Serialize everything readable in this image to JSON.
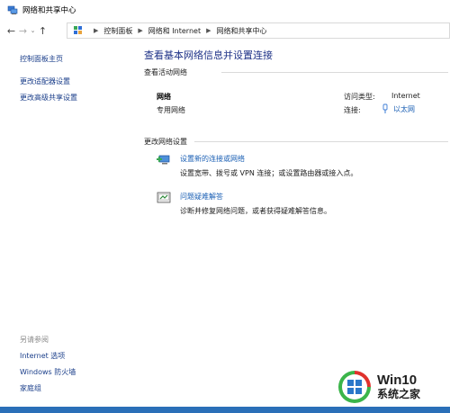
{
  "window": {
    "title": "网络和共享中心"
  },
  "address_bar": {
    "breadcrumbs": [
      "控制面板",
      "网络和 Internet",
      "网络和共享中心"
    ]
  },
  "left_pane": {
    "links": [
      "控制面板主页",
      "更改适配器设置",
      "更改高级共享设置"
    ],
    "see_also_heading": "另请参阅",
    "see_also_links": [
      "Internet 选项",
      "Windows 防火墙",
      "家庭组"
    ]
  },
  "main": {
    "title": "查看基本网络信息并设置连接",
    "active_networks_heading": "查看活动网络",
    "network": {
      "name": "网络",
      "type": "专用网络",
      "access_type_label": "访问类型:",
      "access_type_value": "Internet",
      "connections_label": "连接:",
      "connection_value": "以太网"
    },
    "change_settings_heading": "更改网络设置",
    "tasks": [
      {
        "link": "设置新的连接或网络",
        "desc": "设置宽带、拨号或 VPN 连接；或设置路由器或接入点。"
      },
      {
        "link": "问题疑难解答",
        "desc": "诊断并修复网络问题，或者获得疑难解答信息。"
      }
    ]
  },
  "watermark": {
    "brand": "Win10",
    "subtitle": "系统之家",
    "colors": {
      "green": "#3bb54a",
      "red": "#e0322d"
    }
  },
  "colors": {
    "title_blue": "#1e3287",
    "link_blue": "#1a5fb4",
    "strip_blue": "#2a6fb8"
  }
}
